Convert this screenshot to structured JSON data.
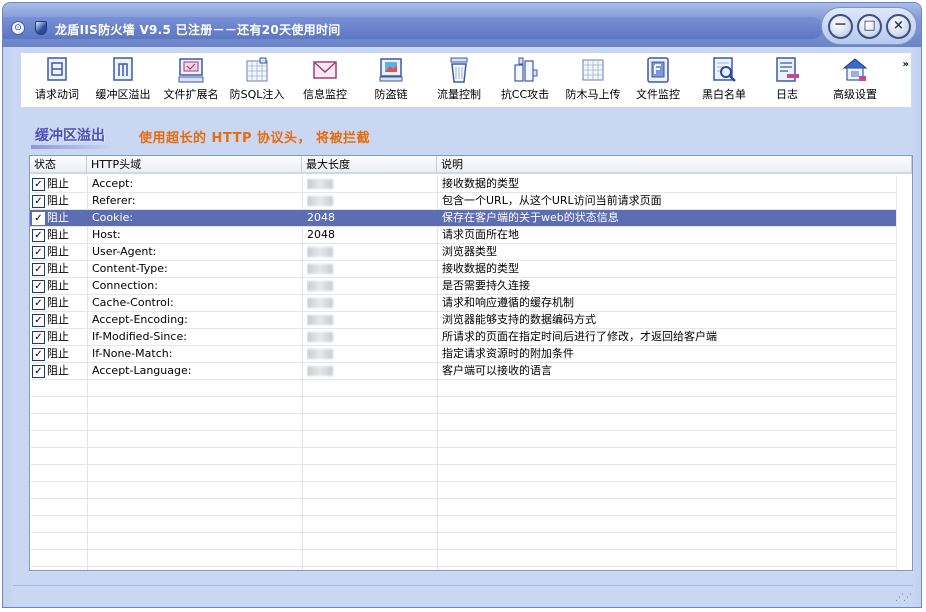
{
  "window": {
    "title": "龙盾IIS防火墙 V9.5 已注册－－还有20天使用时间",
    "system_icon": "menu-circle-icon",
    "buttons": {
      "minimize": "－",
      "maximize": "□",
      "close": "×"
    }
  },
  "toolbar": {
    "overflow": "»",
    "items": [
      {
        "label": "请求动词",
        "icon": "request-verb-icon"
      },
      {
        "label": "缓冲区溢出",
        "icon": "buffer-overflow-icon"
      },
      {
        "label": "文件扩展名",
        "icon": "file-extension-icon"
      },
      {
        "label": "防SQL注入",
        "icon": "sql-injection-icon"
      },
      {
        "label": "信息监控",
        "icon": "mail-monitor-icon"
      },
      {
        "label": "防盗链",
        "icon": "hotlink-protect-icon"
      },
      {
        "label": "流量控制",
        "icon": "traffic-control-icon"
      },
      {
        "label": "抗CC攻击",
        "icon": "cc-attack-icon"
      },
      {
        "label": "防木马上传",
        "icon": "trojan-upload-icon"
      },
      {
        "label": "文件监控",
        "icon": "file-monitor-icon"
      },
      {
        "label": "黑白名单",
        "icon": "black-white-list-icon"
      },
      {
        "label": "日志",
        "icon": "log-icon"
      },
      {
        "label": "高级设置",
        "icon": "advanced-settings-icon"
      }
    ]
  },
  "section": {
    "title": "缓冲区溢出",
    "description": "使用超长的 HTTP 协议头， 将被拦截"
  },
  "grid": {
    "columns": [
      "状态",
      "HTTP头域",
      "最大长度",
      "说明"
    ],
    "rows": [
      {
        "status": "阻止",
        "checked": true,
        "field": "Accept:",
        "max_length": "",
        "desc": "接收数据的类型",
        "selected": false
      },
      {
        "status": "阻止",
        "checked": true,
        "field": "Referer:",
        "max_length": "",
        "desc": "包含一个URL，从这个URL访问当前请求页面",
        "selected": false
      },
      {
        "status": "阻止",
        "checked": true,
        "field": "Cookie:",
        "max_length": "2048",
        "desc": "保存在客户端的关于web的状态信息",
        "selected": true
      },
      {
        "status": "阻止",
        "checked": true,
        "field": "Host:",
        "max_length": "2048",
        "desc": "请求页面所在地",
        "selected": false
      },
      {
        "status": "阻止",
        "checked": true,
        "field": "User-Agent:",
        "max_length": "",
        "desc": "浏览器类型",
        "selected": false
      },
      {
        "status": "阻止",
        "checked": true,
        "field": "Content-Type:",
        "max_length": "",
        "desc": "接收数据的类型",
        "selected": false
      },
      {
        "status": "阻止",
        "checked": true,
        "field": "Connection:",
        "max_length": "",
        "desc": "是否需要持久连接",
        "selected": false
      },
      {
        "status": "阻止",
        "checked": true,
        "field": "Cache-Control:",
        "max_length": "",
        "desc": "请求和响应遵循的缓存机制",
        "selected": false
      },
      {
        "status": "阻止",
        "checked": true,
        "field": "Accept-Encoding:",
        "max_length": "",
        "desc": "浏览器能够支持的数据编码方式",
        "selected": false
      },
      {
        "status": "阻止",
        "checked": true,
        "field": "If-Modified-Since:",
        "max_length": "",
        "desc": "所请求的页面在指定时间后进行了修改，才返回给客户端",
        "selected": false
      },
      {
        "status": "阻止",
        "checked": true,
        "field": "If-None-Match:",
        "max_length": "",
        "desc": "指定请求资源时的附加条件",
        "selected": false
      },
      {
        "status": "阻止",
        "checked": true,
        "field": "Accept-Language:",
        "max_length": "",
        "desc": "客户端可以接收的语言",
        "selected": false
      }
    ],
    "checkmark": "✓"
  },
  "statusbar": {
    "grip": "⋰⋰"
  },
  "colors": {
    "title_gradient_top": "#aabde8",
    "title_gradient_bottom": "#6b84c9",
    "client_bg": "#c9d7f3",
    "section_title": "#4a4fb8",
    "section_desc": "#e86b0c",
    "selection_bg": "#5c6db4"
  }
}
